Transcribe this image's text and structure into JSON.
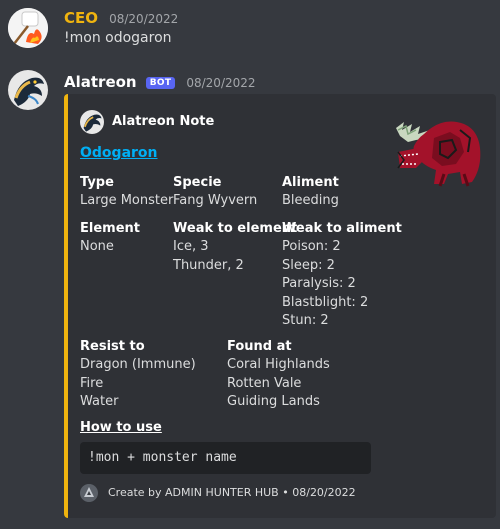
{
  "messages": [
    {
      "author": "CEO",
      "author_color": "#f0b40f",
      "timestamp": "08/20/2022",
      "content": "!mon odogaron",
      "avatar_icon": "marshmallow-fire-icon"
    },
    {
      "author": "Alatreon",
      "author_color": "#ffffff",
      "bot_tag": "BOT",
      "timestamp": "08/20/2022",
      "avatar_icon": "alatreon-dragon-icon"
    }
  ],
  "embed": {
    "color": "#f0b40f",
    "author_name": "Alatreon Note",
    "title": "Odogaron",
    "thumbnail_icon": "odogaron-monster-icon",
    "fields": {
      "type": {
        "name": "Type",
        "values": [
          "Large Monster"
        ]
      },
      "specie": {
        "name": "Specie",
        "values": [
          "Fang Wyvern"
        ]
      },
      "aliment": {
        "name": "Aliment",
        "values": [
          "Bleeding"
        ]
      },
      "element": {
        "name": "Element",
        "values": [
          "None"
        ]
      },
      "weak_element": {
        "name": "Weak to element",
        "values": [
          "Ice, 3",
          "Thunder, 2"
        ]
      },
      "weak_aliment": {
        "name": "Weak to aliment",
        "values": [
          "Poison: 2",
          "Sleep: 2",
          "Paralysis: 2",
          "Blastblight: 2",
          "Stun: 2"
        ]
      },
      "resist": {
        "name": "Resist to",
        "values": [
          "Dragon (Immune)",
          "Fire",
          "Water"
        ]
      },
      "found": {
        "name": "Found at",
        "values": [
          "Coral Highlands",
          "Rotten Vale",
          "Guiding Lands"
        ]
      }
    },
    "how_to_use": "How to use",
    "code": "!mon + monster name",
    "footer": {
      "text": "Create by ADMIN HUNTER HUB",
      "separator": "•",
      "date": "08/20/2022",
      "icon": "hunter-hub-icon"
    }
  }
}
